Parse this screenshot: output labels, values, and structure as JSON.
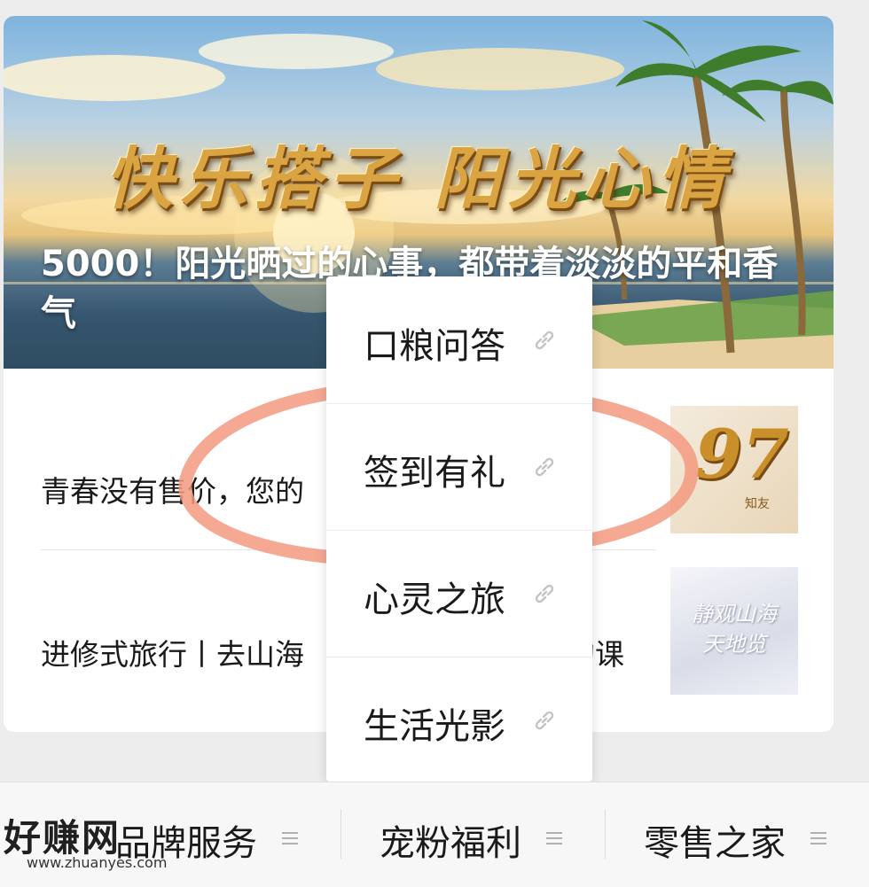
{
  "banner": {
    "headline": "快乐搭子  阳光心情",
    "title": "5000！阳光晒过的心事，都带着淡淡的平和香气"
  },
  "articles": [
    {
      "title": "青春没有售价，您的",
      "title_tail": ""
    },
    {
      "title": "进修式旅行丨去山海",
      "title_tail": "的课",
      "thumb_text": "静观山海\n天地览"
    }
  ],
  "popup_menu": {
    "items": [
      {
        "label": "口粮问答",
        "icon": "link-icon"
      },
      {
        "label": "签到有礼",
        "icon": "link-icon"
      },
      {
        "label": "心灵之旅",
        "icon": "link-icon"
      },
      {
        "label": "生活光影",
        "icon": "link-icon"
      }
    ]
  },
  "bottom_menu": {
    "tabs": [
      {
        "label": "品牌服务",
        "icon": "menu-list-icon"
      },
      {
        "label": "宠粉福利",
        "icon": "menu-list-icon"
      },
      {
        "label": "零售之家",
        "icon": "menu-list-icon"
      }
    ]
  },
  "thumb_1_text": "97",
  "thumb_1_subtext": "知友",
  "watermark": {
    "main": "好赚网",
    "sub": "www.zhuanyes.com"
  },
  "colors": {
    "annotation": "#f39a80",
    "headline_gold": "#d9a441"
  }
}
